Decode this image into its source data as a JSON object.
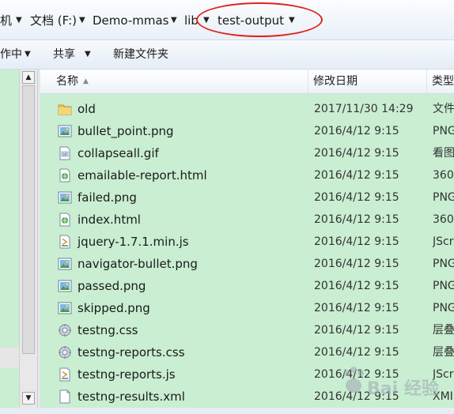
{
  "address": {
    "crumbs": [
      "机",
      "文档 (F:)",
      "Demo-mmas",
      "lib",
      "test-output"
    ]
  },
  "toolbar": {
    "organize_label": "作中",
    "share_label": "共享",
    "new_folder_label": "新建文件夹"
  },
  "columns": {
    "name": "名称",
    "date": "修改日期",
    "type": "类型"
  },
  "files": [
    {
      "name": "old",
      "date": "2017/11/30 14:29",
      "type": "文件",
      "icon": "folder-icon"
    },
    {
      "name": "bullet_point.png",
      "date": "2016/4/12 9:15",
      "type": "PNG",
      "icon": "png-image-icon"
    },
    {
      "name": "collapseall.gif",
      "date": "2016/4/12 9:15",
      "type": "看图",
      "icon": "gif-image-icon"
    },
    {
      "name": "emailable-report.html",
      "date": "2016/4/12 9:15",
      "type": "360",
      "icon": "html-file-icon"
    },
    {
      "name": "failed.png",
      "date": "2016/4/12 9:15",
      "type": "PNG",
      "icon": "png-image-icon"
    },
    {
      "name": "index.html",
      "date": "2016/4/12 9:15",
      "type": "360",
      "icon": "html-file-icon"
    },
    {
      "name": "jquery-1.7.1.min.js",
      "date": "2016/4/12 9:15",
      "type": "JScr",
      "icon": "js-script-icon"
    },
    {
      "name": "navigator-bullet.png",
      "date": "2016/4/12 9:15",
      "type": "PNG",
      "icon": "png-image-icon"
    },
    {
      "name": "passed.png",
      "date": "2016/4/12 9:15",
      "type": "PNG",
      "icon": "png-image-icon"
    },
    {
      "name": "skipped.png",
      "date": "2016/4/12 9:15",
      "type": "PNG",
      "icon": "png-image-icon"
    },
    {
      "name": "testng.css",
      "date": "2016/4/12 9:15",
      "type": "层叠",
      "icon": "css-file-icon"
    },
    {
      "name": "testng-reports.css",
      "date": "2016/4/12 9:15",
      "type": "层叠",
      "icon": "css-file-icon"
    },
    {
      "name": "testng-reports.js",
      "date": "2016/4/12 9:15",
      "type": "JScr",
      "icon": "js-script-icon"
    },
    {
      "name": "testng-results.xml",
      "date": "2016/4/12 9:15",
      "type": "XMI",
      "icon": "xml-file-icon"
    }
  ],
  "watermark": {
    "text": "Bai 经验"
  },
  "colors": {
    "pane_background": "#c9eed1",
    "highlight_ellipse": "#e0231b",
    "folder": "#e8c25a"
  }
}
